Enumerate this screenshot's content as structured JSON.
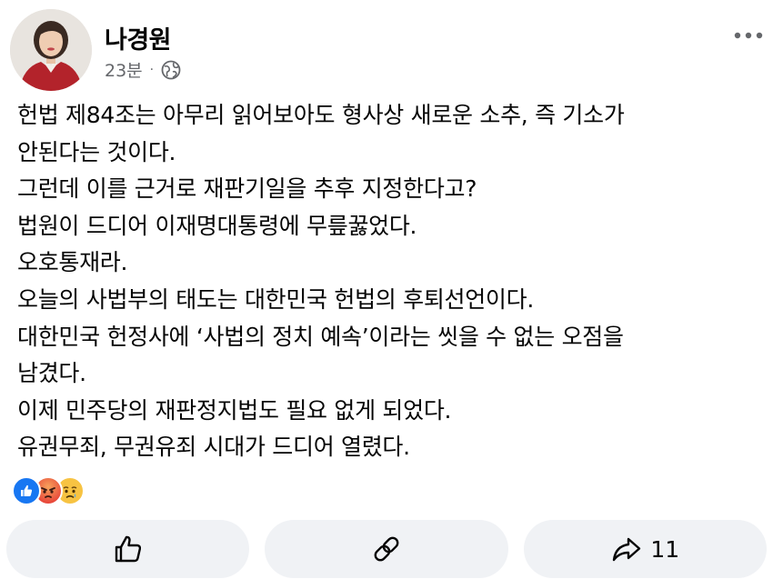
{
  "post": {
    "author": "나경원",
    "time": "23분",
    "separator": "·",
    "privacy_icon": "globe-icon",
    "lines": [
      "헌법 제84조는 아무리 읽어보아도 형사상 새로운 소추, 즉 기소가",
      "안된다는 것이다.",
      "그런데 이를 근거로 재판기일을 추후 지정한다고?",
      "법원이 드디어 이재명대통령에 무릎꿇었다.",
      "오호통재라.",
      "오늘의 사법부의 태도는 대한민국 헌법의 후퇴선언이다.",
      "대한민국 헌정사에 ‘사법의 정치 예속’이라는 씻을 수 없는 오점을",
      "남겼다.",
      "이제 민주당의 재판정지법도 필요 없게 되었다.",
      "유권무죄, 무권유죄 시대가 드디어 열렸다."
    ]
  },
  "reactions": {
    "icons": [
      "like-reaction-icon",
      "angry-reaction-icon",
      "sad-reaction-icon"
    ],
    "colors": {
      "like": "#1877f2",
      "angry": "#f0593e",
      "sad": "#f7b125"
    }
  },
  "actions": {
    "like_icon": "thumbs-up-icon",
    "comment_icon": "link-icon",
    "share_icon": "share-arrow-icon",
    "share_count": "11"
  },
  "colors": {
    "text": "#050505",
    "secondary": "#65676b",
    "button_bg": "#f0f2f5"
  }
}
